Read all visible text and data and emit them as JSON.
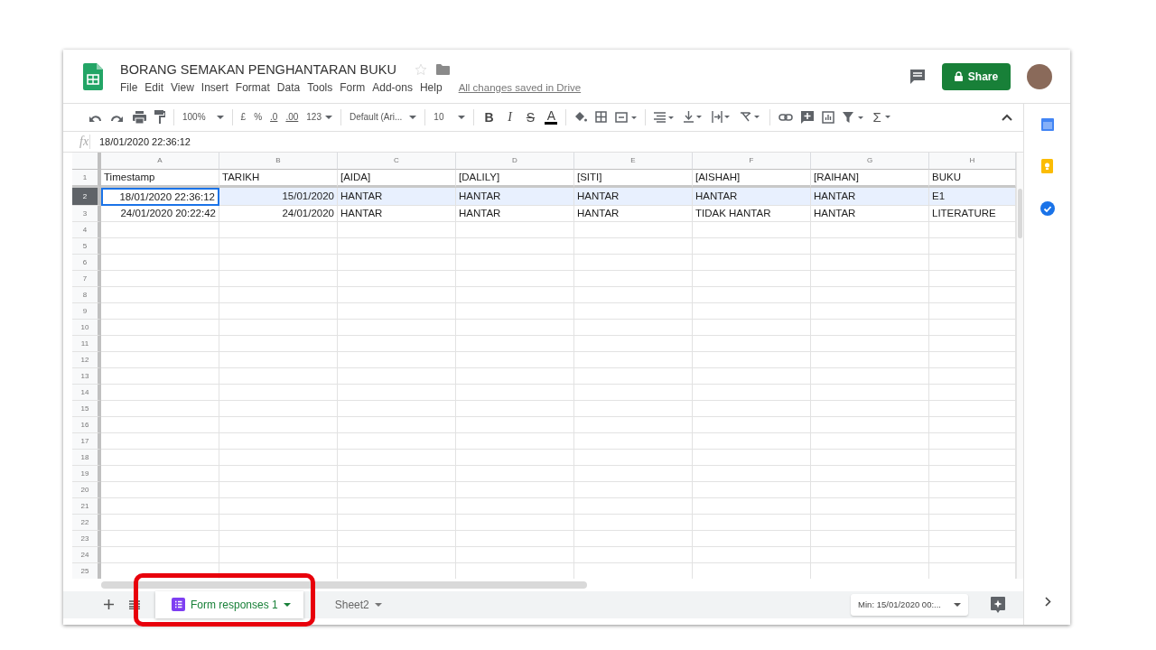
{
  "document": {
    "title": "BORANG SEMAKAN PENGHANTARAN BUKU",
    "menu": [
      "File",
      "Edit",
      "View",
      "Insert",
      "Format",
      "Data",
      "Tools",
      "Form",
      "Add-ons",
      "Help"
    ],
    "save_status": "All changes saved in Drive"
  },
  "share_button": "Share",
  "toolbar": {
    "zoom": "100%",
    "currency": "£",
    "percent": "%",
    "decimal_decrease": ".0",
    "decimal_increase": ".00",
    "number_format": "123",
    "font": "Default (Ari...",
    "font_size": "10",
    "format_buttons": [
      "B",
      "I",
      "S",
      "A"
    ],
    "functions": "Σ"
  },
  "formula_bar": {
    "label": "fx",
    "value": "18/01/2020 22:36:12"
  },
  "columns": [
    "A",
    "B",
    "C",
    "D",
    "E",
    "F",
    "G",
    "H"
  ],
  "rows": [
    {
      "number": "1",
      "selected": false,
      "cells": [
        {
          "text": "Timestamp",
          "numeric": false,
          "active": false
        },
        {
          "text": "TARIKH",
          "numeric": false,
          "active": false
        },
        {
          "text": "[AIDA]",
          "numeric": false,
          "active": false
        },
        {
          "text": "[DALILY]",
          "numeric": false,
          "active": false
        },
        {
          "text": "[SITI]",
          "numeric": false,
          "active": false
        },
        {
          "text": "[AISHAH]",
          "numeric": false,
          "active": false
        },
        {
          "text": "[RAIHAN]",
          "numeric": false,
          "active": false
        },
        {
          "text": "BUKU",
          "numeric": false,
          "active": false
        }
      ]
    },
    {
      "number": "2",
      "selected": true,
      "cells": [
        {
          "text": "18/01/2020 22:36:12",
          "numeric": true,
          "active": true
        },
        {
          "text": "15/01/2020",
          "numeric": true,
          "active": false
        },
        {
          "text": "HANTAR",
          "numeric": false,
          "active": false
        },
        {
          "text": "HANTAR",
          "numeric": false,
          "active": false
        },
        {
          "text": "HANTAR",
          "numeric": false,
          "active": false
        },
        {
          "text": "HANTAR",
          "numeric": false,
          "active": false
        },
        {
          "text": "HANTAR",
          "numeric": false,
          "active": false
        },
        {
          "text": "E1",
          "numeric": false,
          "active": false
        }
      ]
    },
    {
      "number": "3",
      "selected": false,
      "cells": [
        {
          "text": "24/01/2020 20:22:42",
          "numeric": true,
          "active": false
        },
        {
          "text": "24/01/2020",
          "numeric": true,
          "active": false
        },
        {
          "text": "HANTAR",
          "numeric": false,
          "active": false
        },
        {
          "text": "HANTAR",
          "numeric": false,
          "active": false
        },
        {
          "text": "HANTAR",
          "numeric": false,
          "active": false
        },
        {
          "text": "TIDAK HANTAR",
          "numeric": false,
          "active": false
        },
        {
          "text": "HANTAR",
          "numeric": false,
          "active": false
        },
        {
          "text": "LITERATURE",
          "numeric": false,
          "active": false
        }
      ]
    },
    {
      "number": "4",
      "selected": false
    },
    {
      "number": "5",
      "selected": false
    },
    {
      "number": "6",
      "selected": false
    },
    {
      "number": "7",
      "selected": false
    },
    {
      "number": "8",
      "selected": false
    },
    {
      "number": "9",
      "selected": false
    },
    {
      "number": "10",
      "selected": false
    },
    {
      "number": "11",
      "selected": false
    },
    {
      "number": "12",
      "selected": false
    },
    {
      "number": "13",
      "selected": false
    },
    {
      "number": "14",
      "selected": false
    },
    {
      "number": "15",
      "selected": false
    },
    {
      "number": "16",
      "selected": false
    },
    {
      "number": "17",
      "selected": false
    },
    {
      "number": "18",
      "selected": false
    },
    {
      "number": "19",
      "selected": false
    },
    {
      "number": "20",
      "selected": false
    },
    {
      "number": "21",
      "selected": false
    },
    {
      "number": "22",
      "selected": false
    },
    {
      "number": "23",
      "selected": false
    },
    {
      "number": "24",
      "selected": false
    },
    {
      "number": "25",
      "selected": false
    }
  ],
  "sheet_tabs": [
    {
      "label": "Form responses 1",
      "selected": true,
      "kind": "form",
      "annotated": true
    },
    {
      "label": "Sheet2",
      "selected": false,
      "kind": "sheet",
      "annotated": false
    }
  ],
  "explore_summary": "Min: 15/01/2020 00:..."
}
